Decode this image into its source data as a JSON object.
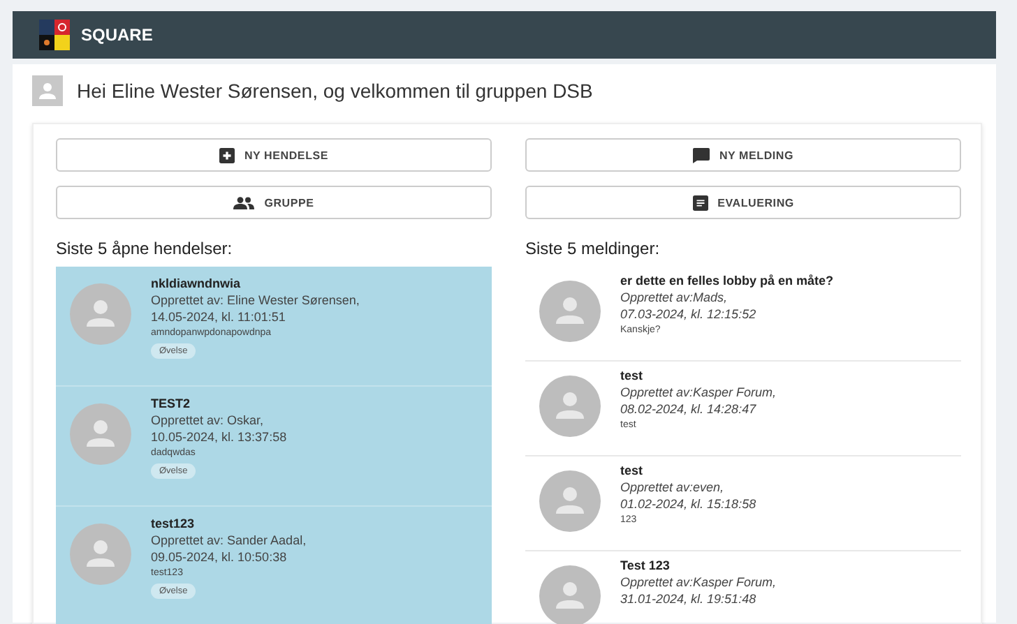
{
  "app": {
    "title": "SQUARE"
  },
  "greeting": "Hei Eline Wester Sørensen, og velkommen til gruppen DSB",
  "buttons": [
    {
      "label": "NY HENDELSE",
      "kind": "plus"
    },
    {
      "label": "NY MELDING",
      "kind": "chat"
    },
    {
      "label": "GRUPPE",
      "kind": "group"
    },
    {
      "label": "EVALUERING",
      "kind": "doc"
    }
  ],
  "events": {
    "heading": "Siste 5 åpne hendelser:",
    "items": [
      {
        "title": "nkldiawndnwia",
        "author": "Opprettet av: Eline Wester Sørensen,",
        "date": "14.05-2024, kl. 11:01:51",
        "description": "amndopanwpdonapowdnpa",
        "tag": "Øvelse"
      },
      {
        "title": "TEST2",
        "author": "Opprettet av: Oskar,",
        "date": "10.05-2024, kl. 13:37:58",
        "description": "dadqwdas",
        "tag": "Øvelse"
      },
      {
        "title": "test123",
        "author": "Opprettet av: Sander Aadal,",
        "date": "09.05-2024, kl. 10:50:38",
        "description": "test123",
        "tag": "Øvelse"
      }
    ]
  },
  "messages": {
    "heading": "Siste 5 meldinger:",
    "items": [
      {
        "title": "er dette en felles lobby på en måte?",
        "author": "Opprettet av:Mads,",
        "date": "07.03-2024, kl. 12:15:52",
        "body": "Kanskje?"
      },
      {
        "title": "test",
        "author": "Opprettet av:Kasper Forum,",
        "date": "08.02-2024, kl. 14:28:47",
        "body": "test"
      },
      {
        "title": "test",
        "author": "Opprettet av:even,",
        "date": "01.02-2024, kl. 15:18:58",
        "body": "123"
      },
      {
        "title": "Test 123",
        "author": "Opprettet av:Kasper Forum,",
        "date": "31.01-2024, kl. 19:51:48"
      }
    ]
  }
}
